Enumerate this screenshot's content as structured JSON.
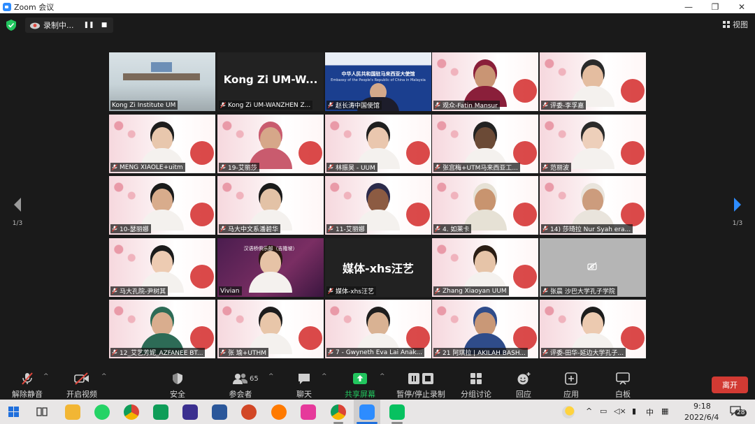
{
  "window": {
    "title": "Zoom 会议",
    "minimize": "—",
    "maximize": "❐",
    "close": "✕"
  },
  "recording": {
    "label": "录制中...",
    "pause": "❚❚",
    "stop": "■"
  },
  "view_button": {
    "label": "视图"
  },
  "pager": {
    "left_count": "1/3",
    "right_count": "1/3"
  },
  "tiles": [
    {
      "name": "Kong Zi Institute UM",
      "kind": "office",
      "active": true,
      "muted": false
    },
    {
      "name": "Kong Zi UM-WANZHEN Z...",
      "kind": "dark",
      "big": "Kong Zi UM-W...",
      "muted": true
    },
    {
      "name": "赵长涛中国使馆",
      "kind": "embassy",
      "banner": "中华人民共和国驻马来西亚大使馆",
      "banner_sub": "Embassy of the People's Republic of China in Malaysia",
      "muted": true
    },
    {
      "name": "观众-Fatin Mansur",
      "kind": "bridge",
      "muted": true,
      "hijab": "#8a1f3a",
      "skin": "#c99574"
    },
    {
      "name": "评委-李孚嘉",
      "kind": "bridge",
      "muted": true,
      "hair": "#2a2a2a",
      "skin": "#e4bda0"
    },
    {
      "name": "MENG XIAOLE+uitm",
      "kind": "bridge",
      "muted": true,
      "hair": "#1d1d1d",
      "skin": "#e8c7ad"
    },
    {
      "name": "19-艾丽莎",
      "kind": "bridge",
      "muted": true,
      "hijab": "#c95b6e",
      "skin": "#d6a789"
    },
    {
      "name": "林振昊 - UUM",
      "kind": "bridge",
      "muted": true,
      "hair": "#1f1f1f",
      "skin": "#eac7ae"
    },
    {
      "name": "张宫梅+UTM马来西亚工...",
      "kind": "bridge",
      "muted": true,
      "hair": "#222",
      "skin": "#6b4a36"
    },
    {
      "name": "范丽波",
      "kind": "bridge",
      "muted": true,
      "hair": "#2a2a2a",
      "skin": "#edcfba"
    },
    {
      "name": "10-瑟丽娜",
      "kind": "bridge",
      "muted": true,
      "hair": "#1a1a1a",
      "skin": "#d8ac8c"
    },
    {
      "name": "马大中文系潘碧华",
      "kind": "bridge-plain",
      "muted": true,
      "hair": "#1a1a1a",
      "skin": "#e3c2a6"
    },
    {
      "name": "11-艾丽娜",
      "kind": "bridge",
      "muted": true,
      "hair": "#2c2a4a",
      "skin": "#8c5b42"
    },
    {
      "name": "4. 如莱卡",
      "kind": "bridge",
      "muted": true,
      "hijab": "#e6e1d5",
      "skin": "#c8946f"
    },
    {
      "name": "14) 莎琦拉 Nur Syah era...",
      "kind": "bridge",
      "muted": true,
      "hijab": "#e9e4dc",
      "skin": "#cc9c7d"
    },
    {
      "name": "马大孔院-尹树其",
      "kind": "bridge",
      "muted": true,
      "hair": "#1b1b1b",
      "skin": "#edcbb2"
    },
    {
      "name": "Vivian",
      "kind": "vivian",
      "banner": "汉语桥俱乐部（吉隆坡）",
      "muted": false,
      "hair": "#2a1a12",
      "skin": "#e6c3a6"
    },
    {
      "name": "媒体-xhs汪艺",
      "kind": "dark",
      "big": "媒体-xhs汪艺",
      "muted": true
    },
    {
      "name": "Zhang Xiaoyan  UUM",
      "kind": "bridge",
      "muted": true,
      "hair": "#2a1d14",
      "skin": "#e6c4a8"
    },
    {
      "name": "张晨 沙巴大学孔子学院",
      "kind": "gray",
      "muted": true
    },
    {
      "name": "12_艾艺芳妮_AZFANEE BT...",
      "kind": "bridge",
      "muted": true,
      "hijab": "#2d6b56",
      "skin": "#d9ad8e"
    },
    {
      "name": "张 瑜+UTHM",
      "kind": "bridge",
      "muted": true,
      "hair": "#1c1c1c",
      "skin": "#e8c6a9"
    },
    {
      "name": "7 - Gwyneth Eva Lai Anak...",
      "kind": "bridge",
      "muted": true,
      "hair": "#1e1e1e",
      "skin": "#d9b293"
    },
    {
      "name": "21 阿琪拉 | AKILAH BASH...",
      "kind": "bridge",
      "muted": true,
      "hijab": "#2f4c8a",
      "skin": "#c99877"
    },
    {
      "name": "评委-田华-延边大学孔子...",
      "kind": "bridge",
      "muted": true,
      "hair": "#1c1c1c",
      "skin": "#eccab0"
    }
  ],
  "toolbar": {
    "unmute": "解除静音",
    "start_video": "开启视频",
    "security": "安全",
    "participants": "参会者",
    "participants_count": "65",
    "chat": "聊天",
    "share": "共享屏幕",
    "record": "暂停/停止录制",
    "breakout": "分组讨论",
    "reactions": "回应",
    "apps": "应用",
    "whiteboard": "白板",
    "leave": "离开"
  },
  "taskbar": {
    "time": "9:18",
    "date": "2022/6/4",
    "ime": "中",
    "notifications": "28",
    "caret": "^"
  },
  "colors": {
    "accent_green": "#22c55e",
    "leave_red": "#d23a33",
    "active_border": "#b6e23a",
    "zoom_blue": "#2d8cff"
  }
}
